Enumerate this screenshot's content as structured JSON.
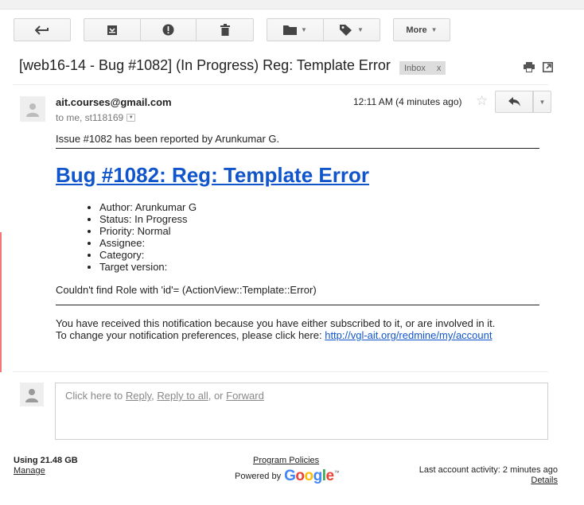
{
  "toolbar": {
    "more_label": "More"
  },
  "subject": {
    "title": "[web16-14 - Bug #1082] (In Progress) Reg: Template Error",
    "label": "Inbox",
    "label_close": "x"
  },
  "message": {
    "sender": "ait.courses@gmail.com",
    "recipients": "to me, st118169",
    "time": "12:11 AM (4 minutes ago)",
    "intro": "Issue #1082 has been reported by Arunkumar G.",
    "bug_title": "Bug #1082: Reg: Template Error",
    "attributes": [
      "Author: Arunkumar G",
      "Status: In Progress",
      "Priority: Normal",
      "Assignee:",
      "Category:",
      "Target version:"
    ],
    "error_text": "Couldn't find Role with 'id'= (ActionView::Template::Error)",
    "notice_line1": "You have received this notification because you have either subscribed to it, or are involved in it.",
    "notice_line2": "To change your notification preferences, please click here:",
    "notice_link": "http://vgl-ait.org/redmine/my/account"
  },
  "reply": {
    "prefix": "Click here to",
    "reply": "Reply",
    "sep1": ",",
    "reply_all": "Reply to all",
    "sep2": ", or",
    "forward": "Forward"
  },
  "footer": {
    "storage": "Using 21.48 GB",
    "manage": "Manage",
    "policies": "Program Policies",
    "powered_by": "Powered by",
    "google": [
      "G",
      "o",
      "o",
      "g",
      "l",
      "e"
    ],
    "trademark": "™",
    "activity": "Last account activity: 2 minutes ago",
    "details": "Details"
  },
  "colors": {
    "link": "#1155cc",
    "chip_bg": "#dddddd"
  },
  "icons": [
    "back-arrow-icon",
    "archive-icon",
    "report-spam-icon",
    "delete-icon",
    "folder-icon",
    "label-icon",
    "print-icon",
    "new-window-icon",
    "star-icon",
    "reply-icon",
    "avatar-icon"
  ]
}
